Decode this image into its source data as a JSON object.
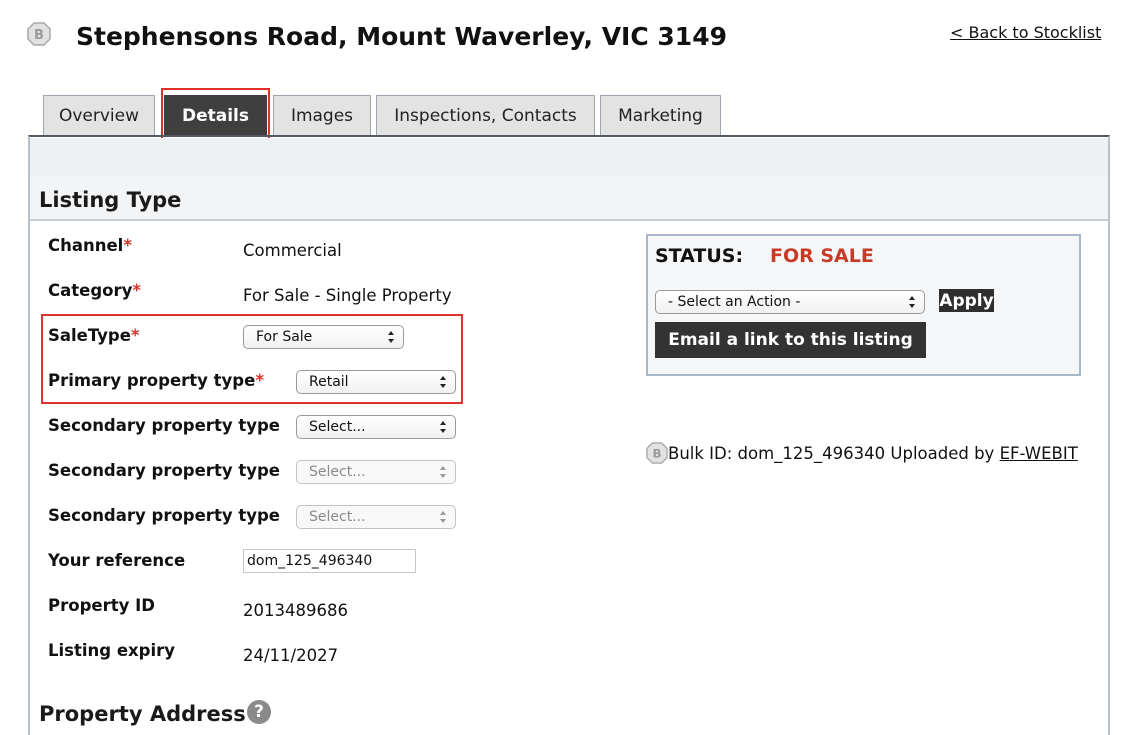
{
  "header": {
    "title": "Stephensons Road, Mount Waverley, VIC 3149",
    "back_link": "< Back to Stocklist"
  },
  "tabs": [
    {
      "label": "Overview",
      "active": false
    },
    {
      "label": "Details",
      "active": true
    },
    {
      "label": "Images",
      "active": false
    },
    {
      "label": "Inspections, Contacts",
      "active": false
    },
    {
      "label": "Marketing",
      "active": false
    }
  ],
  "listing_type": {
    "section_title": "Listing Type",
    "channel": {
      "label": "Channel",
      "value": "Commercial"
    },
    "category": {
      "label": "Category",
      "value": "For Sale - Single Property"
    },
    "sale_type": {
      "label": "SaleType",
      "value": "For Sale"
    },
    "primary_property_type": {
      "label": "Primary property type",
      "value": "Retail"
    },
    "secondary_property_type_1": {
      "label": "Secondary property type",
      "value": "Select..."
    },
    "secondary_property_type_2": {
      "label": "Secondary property type",
      "value": "Select..."
    },
    "secondary_property_type_3": {
      "label": "Secondary property type",
      "value": "Select..."
    },
    "your_reference": {
      "label": "Your reference",
      "value": "dom_125_496340"
    },
    "property_id": {
      "label": "Property ID",
      "value": "2013489686"
    },
    "listing_expiry": {
      "label": "Listing expiry",
      "value": "24/11/2027"
    },
    "required_marker": "*"
  },
  "status": {
    "label": "STATUS:",
    "value": "FOR SALE",
    "action_select": "- Select an Action -",
    "apply_label": "Apply",
    "email_label": "Email a link to this listing"
  },
  "bulk": {
    "text": "Bulk ID: dom_125_496340 Uploaded by ",
    "uploader": "EF-WEBIT"
  },
  "next_section": {
    "title": "Property Address",
    "help_glyph": "?"
  },
  "colors": {
    "active_tab": "#3f3f3f",
    "required": "#d8342b",
    "status_value": "#c63a26",
    "highlight": "#e0302a"
  }
}
